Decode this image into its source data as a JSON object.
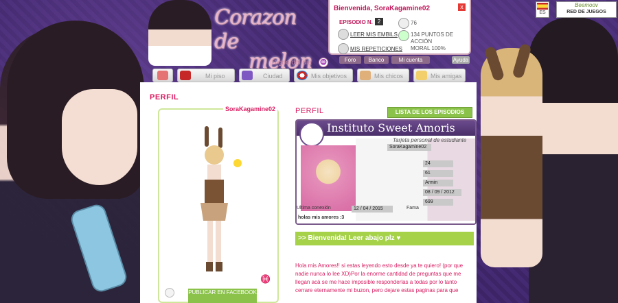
{
  "logo": {
    "line1": "Corazon de",
    "line2": "melon"
  },
  "sign_label": "Signo del dia",
  "user_panel": {
    "welcome": "Bienvenida, SoraKagamine02",
    "episode_label": "EPISODIO N.",
    "episode_number": "2",
    "messages_link": "LEER MIS EMBILS",
    "repeats_link": "MIS REPETICIONES",
    "coins": "76",
    "action_points": "134 PUNTOS DE ACCIÓN",
    "morale": "MORAL 100%",
    "buttons": [
      "Foro",
      "Banco",
      "Mi cuenta"
    ],
    "help": "Ayuda"
  },
  "lang": {
    "flag": "ES"
  },
  "network": {
    "line1": "Beemoov",
    "line2": "RED DE JUEGOS"
  },
  "nav": {
    "tabs": [
      {
        "id": "home",
        "label": ""
      },
      {
        "id": "piso",
        "label": "Mi piso"
      },
      {
        "id": "ciudad",
        "label": "Ciudad"
      },
      {
        "id": "objetivos",
        "label": "Mis objetivos"
      },
      {
        "id": "chicos",
        "label": "Mis chicos"
      },
      {
        "id": "amigas",
        "label": "Mis amigas"
      }
    ]
  },
  "profile": {
    "section_title": "PERFIL",
    "username": "SoraKagamine02",
    "publish_button": "PUBLICAR EN FACEBOOK",
    "right_title": "PERFIL",
    "episodes_button": "LISTA DE LOS EPISODIOS"
  },
  "card": {
    "title": "Instituto Sweet Amoris",
    "subtitle": "Tarjeta personal de estudiante",
    "name": "SoraKagamine02",
    "age": "24",
    "field2": "61",
    "lover": "Armin",
    "date1": "08 / 09 / 2012",
    "points": "699",
    "date2": "12 / 04 / 2015",
    "label_last": "Ultima conexión",
    "label_points": "Fama",
    "bio": "holas mis amores :3"
  },
  "welcome_banner": ">> Bienvenida! Leer abajo plz ♥",
  "body_text": "Hola mis Amores!! si estas leyendo esto desde ya te quiero! (por que nadie nunca lo lee XD)Por la enorme cantidad de preguntas que me llegan acá se me hace imposible responderlas a todas por lo tanto cerrare eternamente mi buzon, pero dejare estas paginas para que"
}
